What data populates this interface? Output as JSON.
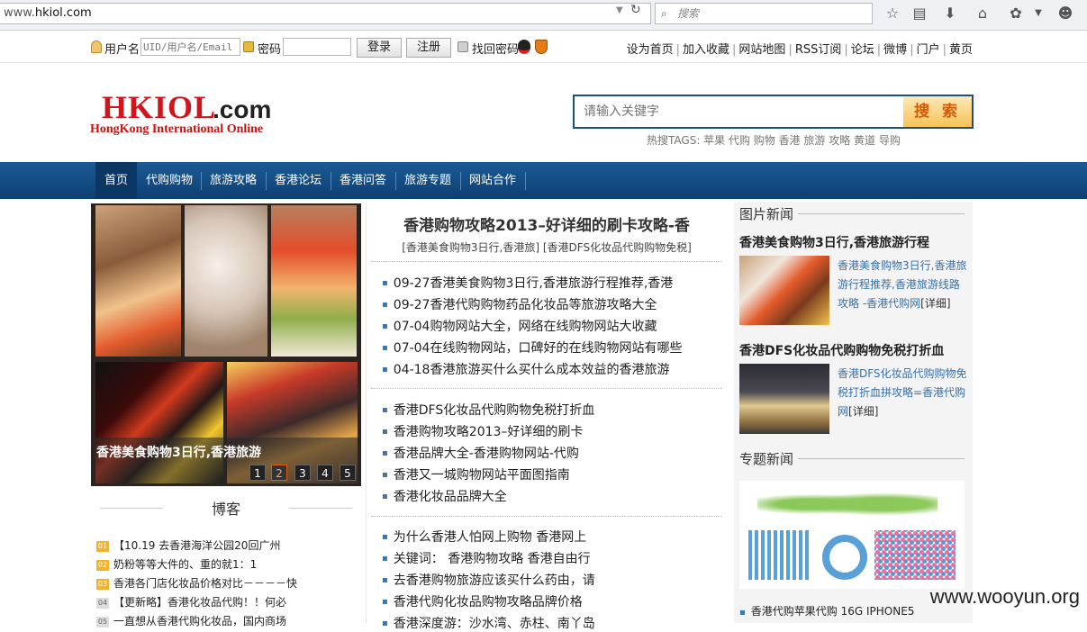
{
  "browser": {
    "url_prefix": "www.",
    "url_domain": "hkiol.com",
    "search_placeholder": "搜索"
  },
  "loginbar": {
    "username_label": "用户名",
    "username_placeholder": "UID/用户名/Email",
    "password_label": "密码",
    "login_button": "登录",
    "register_button": "注册",
    "recover_label": "找回密码",
    "links": [
      "设为首页",
      "加入收藏",
      "网站地图",
      "RSS订阅",
      "论坛",
      "微博",
      "门户",
      "黄页"
    ]
  },
  "logo": {
    "main": "HKIOL",
    "suffix": ".com",
    "subtitle": "HongKong International Online"
  },
  "search": {
    "placeholder": "请输入关键字",
    "button": "搜 索",
    "hot_tags": "热搜TAGS: 苹果 代购 购物 香港 旅游 攻略 黄道 导购"
  },
  "nav": [
    "首页",
    "代购购物",
    "旅游攻略",
    "香港论坛",
    "香港问答",
    "旅游专题",
    "网站合作"
  ],
  "slideshow": {
    "caption": "香港美食购物3日行,香港旅游",
    "pages": [
      "1",
      "2",
      "3",
      "4",
      "5"
    ],
    "current_page": 2
  },
  "blog": {
    "title": "博客",
    "items": [
      {
        "num": "01",
        "text": "【10.19 去香港海洋公园20回广州"
      },
      {
        "num": "02",
        "text": "奶粉等等大件的、重的就1：1"
      },
      {
        "num": "03",
        "text": "香港各门店化妆品价格对比－－－－快"
      },
      {
        "num": "04",
        "text": "【更新略】香港化妆品代购！！何必"
      },
      {
        "num": "05",
        "text": "一直想从香港代购化妆品，国内商场"
      }
    ]
  },
  "middle": {
    "headline": "香港购物攻略2013–好详细的刷卡攻略-香",
    "subline": "[香港美食购物3日行,香港旅] [香港DFS化妆品代购购物免税]",
    "group1": [
      "09-27香港美食购物3日行,香港旅游行程推荐,香港",
      "09-27香港代购购物药品化妆品等旅游攻略大全",
      "07-04购物网站大全，网络在线购物网站大收藏",
      "07-04在线购物网站，口碑好的在线购物网站有哪些",
      "04-18香港旅游买什么买什么成本效益的香港旅游"
    ],
    "group2": [
      "香港DFS化妆品代购购物免税打折血",
      "香港购物攻略2013–好详细的刷卡",
      "香港品牌大全-香港购物网站-代购",
      "香港又一城购物网站平面图指南",
      "香港化妆品品牌大全"
    ],
    "group3": [
      "为什么香港人怕网上购物 香港网上",
      "关键词： 香港购物攻略 香港自由行",
      "去香港购物旅游应该买什么药由，请",
      "香港代购化妆品购物攻略品牌价格",
      "香港深度游：沙水湾、赤柱、南丫岛"
    ]
  },
  "right": {
    "photo_news_title": "图片新闻",
    "story1": {
      "headline": "香港美食购物3日行,香港旅游行程",
      "text": "香港美食购物3日行,香港旅游行程推荐,香港旅游线路攻略 -香港代购网",
      "detail": "[详细]"
    },
    "story2": {
      "headline": "香港DFS化妆品代购购物免税打折血",
      "text": "香港DFS化妆品代购购物免税打折血拼攻略=香港代购网",
      "detail": "[详细]"
    },
    "topic_title": "专题新闻",
    "footer_item": "香港代购苹果代购 16G IPHONE5"
  },
  "watermark": "www.wooyun.org"
}
